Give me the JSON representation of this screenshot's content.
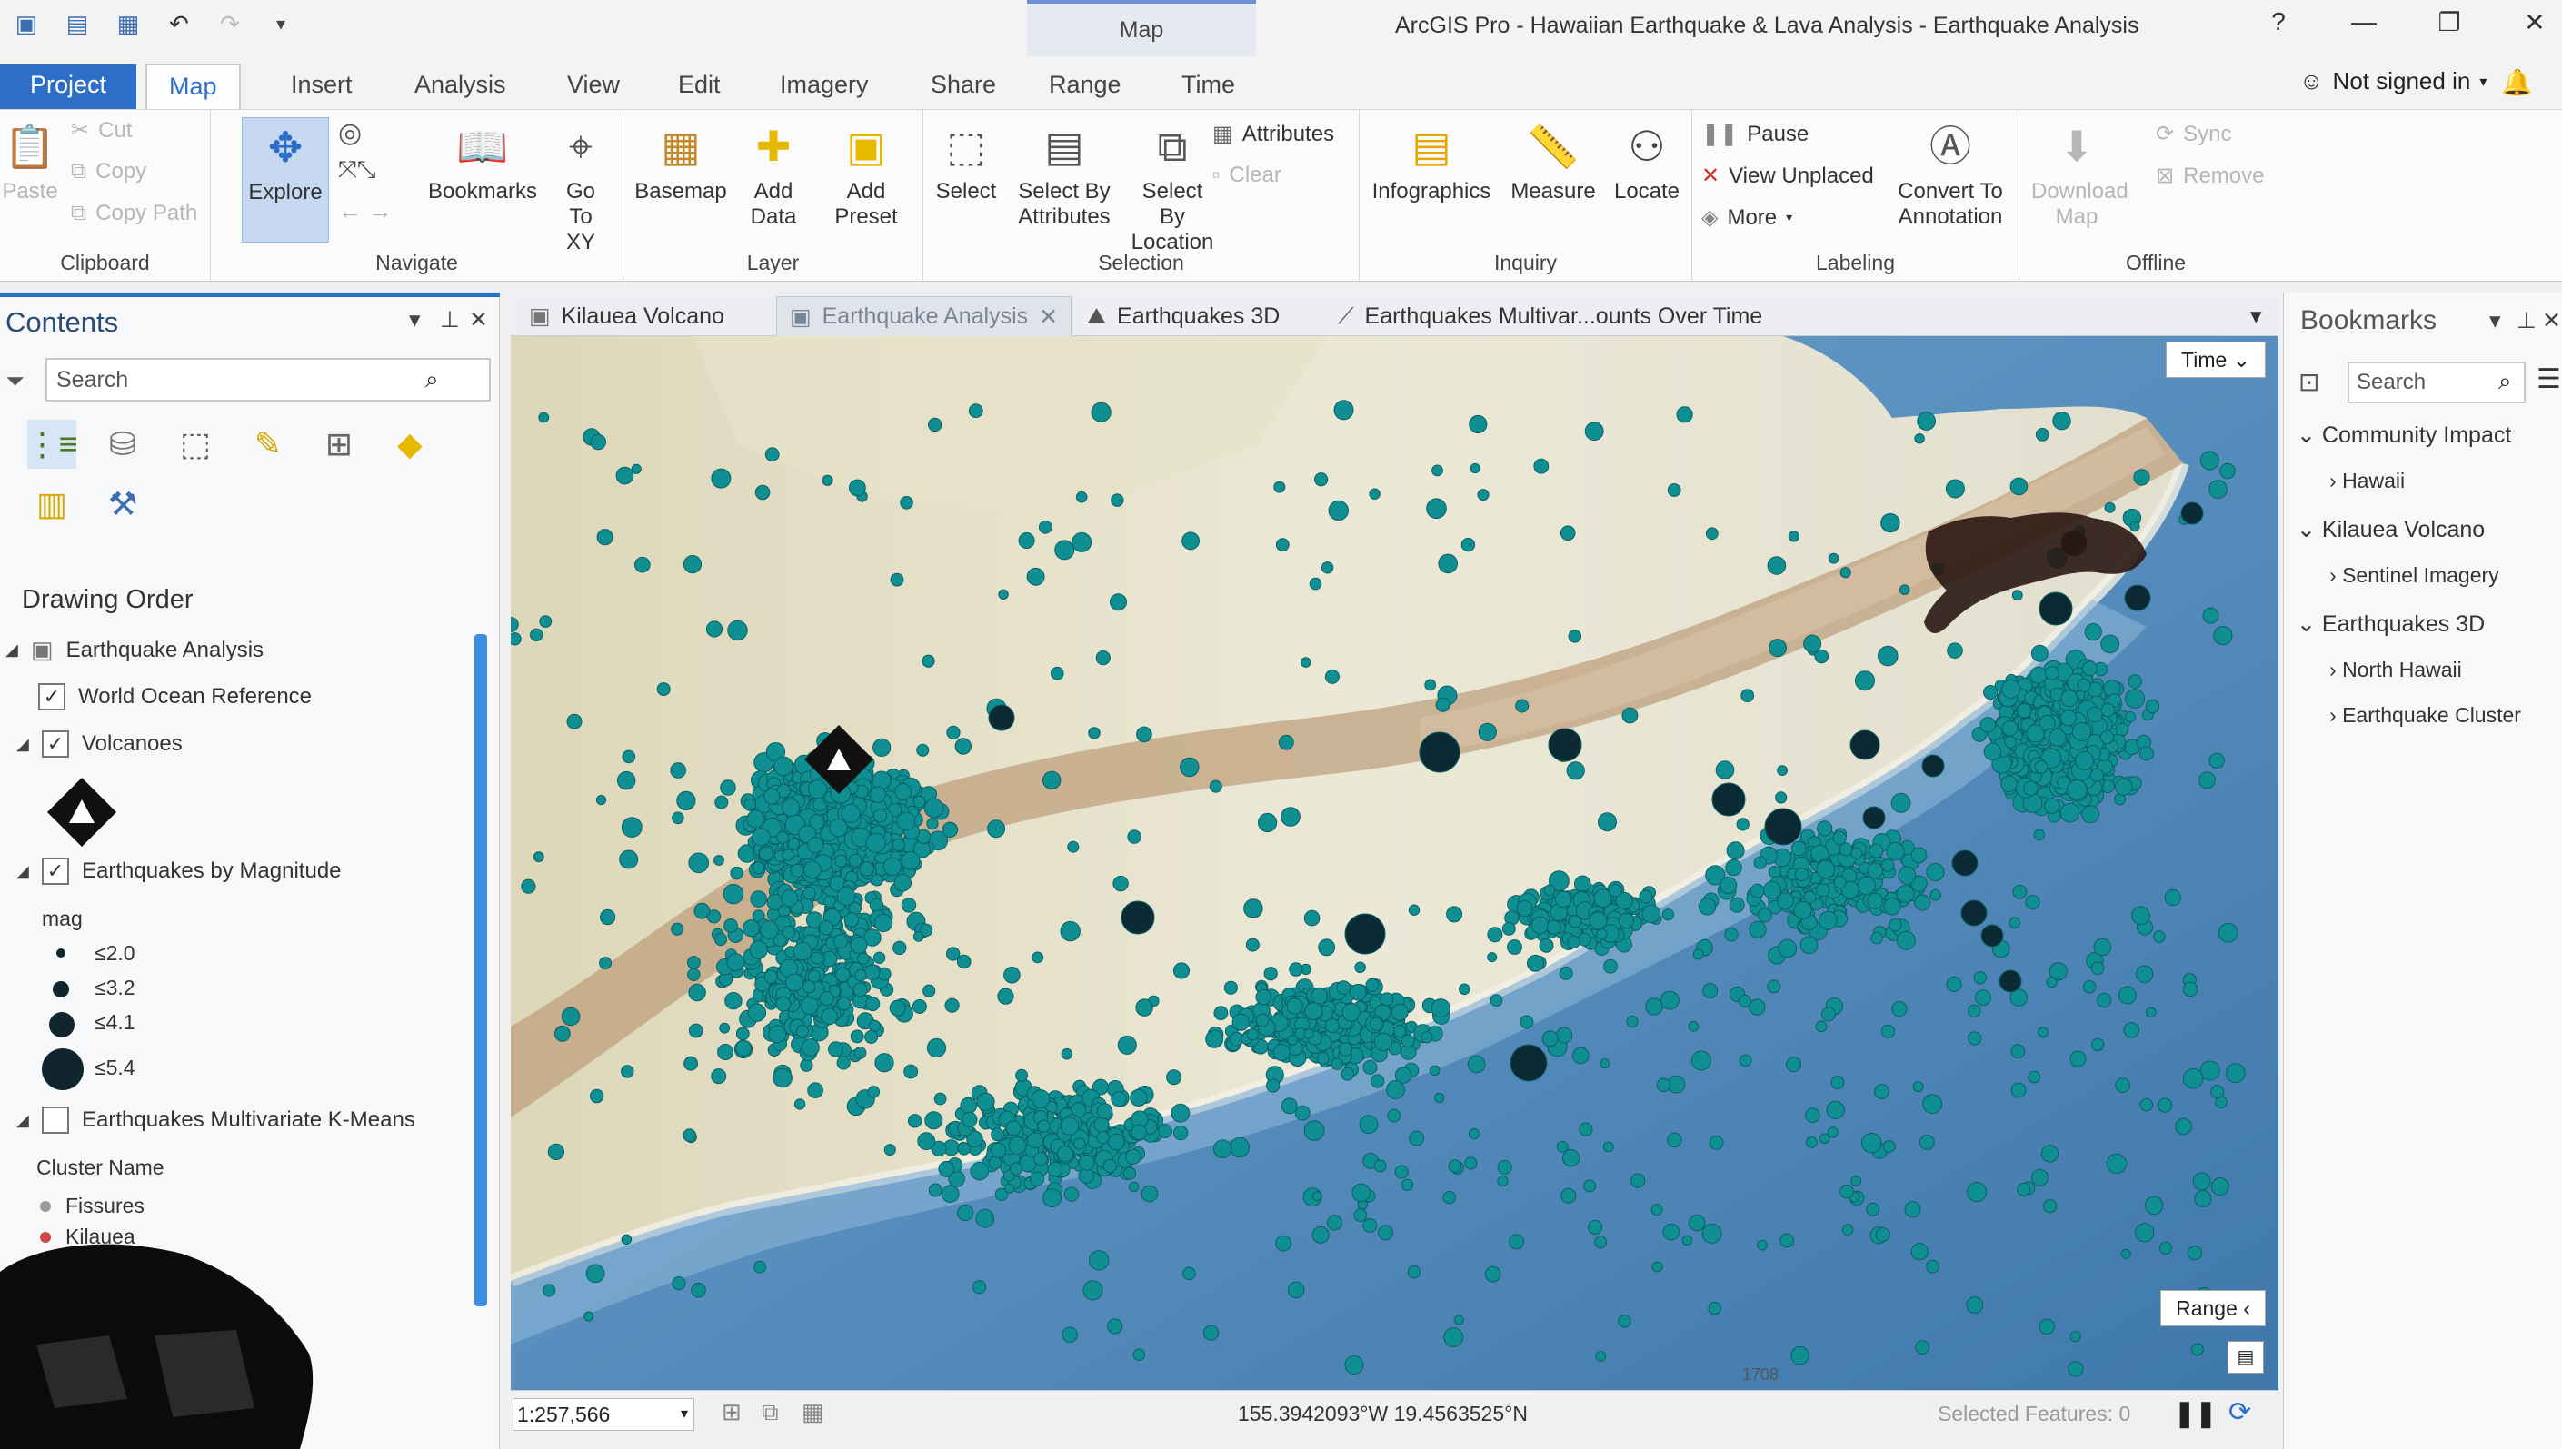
{
  "window": {
    "title": "ArcGIS Pro - Hawaiian Earthquake & Lava Analysis - Earthquake Analysis",
    "context_tab": "Map",
    "help": "?",
    "minimize": "—",
    "maximize": "❐",
    "close": "✕"
  },
  "quick_access": [
    "new-project-icon",
    "open-project-icon",
    "save-project-icon",
    "undo-icon",
    "redo-icon",
    "customize-icon"
  ],
  "ribbon_tabs": [
    "Project",
    "Map",
    "Insert",
    "Analysis",
    "View",
    "Edit",
    "Imagery",
    "Share",
    "Range",
    "Time"
  ],
  "user": {
    "signin": "Not signed in"
  },
  "ribbon": {
    "clipboard": {
      "label": "Clipboard",
      "paste": "Paste",
      "cut": "Cut",
      "copy": "Copy",
      "copy_path": "Copy Path"
    },
    "navigate": {
      "label": "Navigate",
      "explore": "Explore",
      "bookmarks": "Bookmarks",
      "goto": "Go To XY"
    },
    "layer": {
      "label": "Layer",
      "basemap": "Basemap",
      "add_data": "Add Data",
      "add_preset": "Add Preset"
    },
    "selection": {
      "label": "Selection",
      "select": "Select",
      "select_by_attr": "Select By Attributes",
      "select_by_loc": "Select By Location",
      "attributes": "Attributes",
      "clear": "Clear"
    },
    "inquiry": {
      "label": "Inquiry",
      "infographics": "Infographics",
      "measure": "Measure",
      "locate": "Locate"
    },
    "labeling": {
      "label": "Labeling",
      "pause": "Pause",
      "view_unplaced": "View Unplaced",
      "more": "More",
      "convert": "Convert To Annotation"
    },
    "offline": {
      "label": "Offline",
      "download": "Download Map",
      "sync": "Sync",
      "remove": "Remove"
    }
  },
  "contents": {
    "title": "Contents",
    "search_placeholder": "Search",
    "drawing_order": "Drawing Order",
    "map_name": "Earthquake Analysis",
    "layers": {
      "ocean": "World Ocean Reference",
      "volcanoes": "Volcanoes",
      "eq_mag": "Earthquakes by Magnitude",
      "mag_field": "mag",
      "legend": [
        "≤2.0",
        "≤3.2",
        "≤4.1",
        "≤5.4"
      ],
      "kmeans": "Earthquakes Multivariate K-Means",
      "cluster_name": "Cluster Name",
      "cluster_1": "Fissures",
      "cluster_2": "Kilauea"
    }
  },
  "map_tabs": [
    "Kilauea Volcano",
    "Earthquake Analysis",
    "Earthquakes 3D",
    "Earthquakes Multivar...ounts Over Time"
  ],
  "map": {
    "time_button": "Time",
    "range_button": "Range",
    "scale_text": "1708"
  },
  "status": {
    "scale": "1:257,566",
    "coords": "155.3942093°W 19.4563525°N",
    "selected": "Selected Features: 0"
  },
  "bookmarks": {
    "title": "Bookmarks",
    "search_placeholder": "Search",
    "groups": [
      {
        "name": "Community Impact",
        "items": [
          "Hawaii"
        ]
      },
      {
        "name": "Kilauea Volcano",
        "items": [
          "Sentinel Imagery"
        ]
      },
      {
        "name": "Earthquakes 3D",
        "items": [
          "North Hawaii",
          "Earthquake Cluster"
        ]
      }
    ]
  },
  "colors": {
    "quake": "#0f8f92",
    "quake_dark": "#0c2a33",
    "lava": "#2a1712",
    "rift": "#b89a78",
    "ocean": "#4b86b8",
    "land": "#e7e3cf",
    "accent": "#2d6ec8"
  }
}
